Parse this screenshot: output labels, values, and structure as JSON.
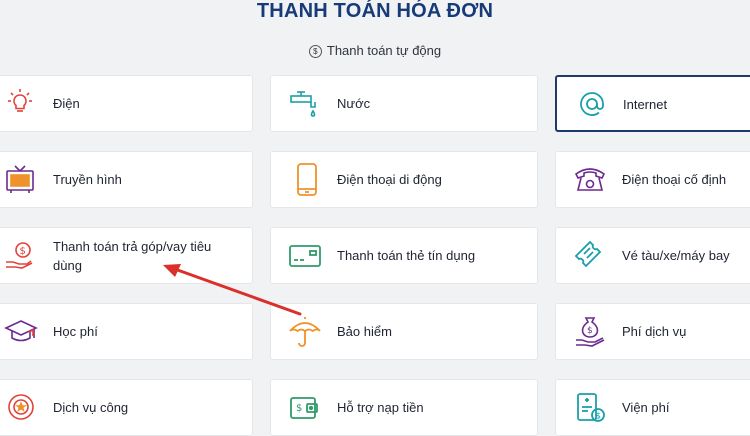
{
  "header": {
    "title": "THANH TOÁN HÓA ĐƠN",
    "subtitle": "Thanh toán tự động",
    "subtitle_icon": "dollar-coin-icon"
  },
  "services": [
    {
      "label": "Điện",
      "icon": "lightbulb-icon"
    },
    {
      "label": "Nước",
      "icon": "water-tap-icon"
    },
    {
      "label": "Internet",
      "icon": "at-sign-icon",
      "selected": true
    },
    {
      "label": "Truyền hình",
      "icon": "tv-icon"
    },
    {
      "label": "Điện thoại di động",
      "icon": "mobile-phone-icon"
    },
    {
      "label": "Điện thoại cố định",
      "icon": "landline-phone-icon"
    },
    {
      "label": "Thanh toán trả góp/vay tiêu dùng",
      "icon": "installment-money-icon"
    },
    {
      "label": "Thanh toán thẻ tín dụng",
      "icon": "credit-card-icon"
    },
    {
      "label": "Vé tàu/xe/máy bay",
      "icon": "ticket-icon"
    },
    {
      "label": "Học phí",
      "icon": "graduation-cap-icon"
    },
    {
      "label": "Bảo hiểm",
      "icon": "umbrella-icon"
    },
    {
      "label": "Phí dịch vụ",
      "icon": "money-bag-hand-icon"
    },
    {
      "label": "Dịch vụ công",
      "icon": "state-emblem-icon"
    },
    {
      "label": "Hỗ trợ nạp tiền",
      "icon": "wallet-icon"
    },
    {
      "label": "Viện phí",
      "icon": "medical-bill-icon"
    }
  ],
  "colors": {
    "title": "#173a78",
    "icon_red": "#e0433b",
    "icon_teal": "#1aa0a8",
    "icon_orange": "#f0922b",
    "icon_purple": "#6c2a8f",
    "icon_green": "#2f9b6a",
    "annotation_arrow": "#d9302c"
  }
}
